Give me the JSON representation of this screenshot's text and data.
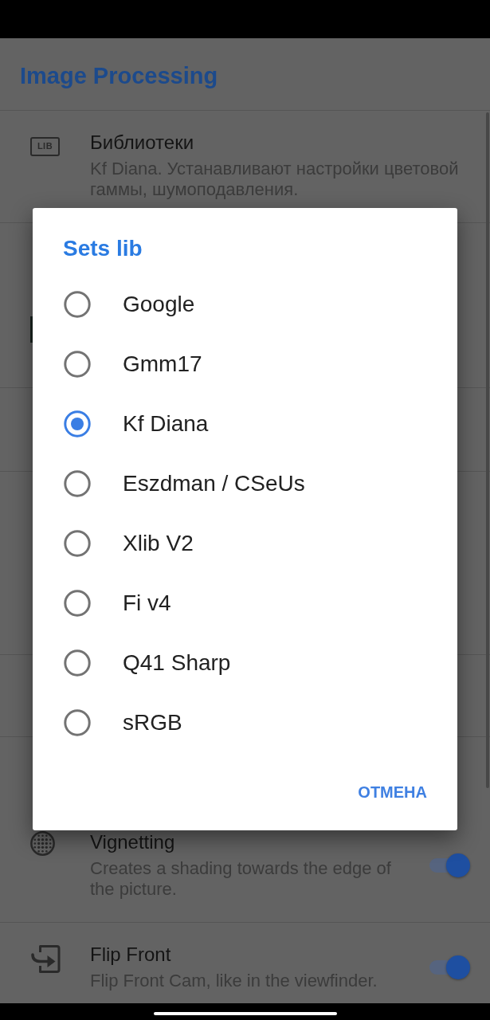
{
  "app_bar": {
    "title": "Image Processing"
  },
  "settings": [
    {
      "kind": "info",
      "icon_label": "LIB",
      "title": "Библиотеки",
      "description": "Kf Diana. Устанавливают настройки цветовой гаммы, шумоподавления."
    },
    {
      "kind": "switch",
      "title": "Vignetting",
      "description": "Creates a shading towards the edge of the picture.",
      "on": true
    },
    {
      "kind": "switch",
      "title": "Flip Front",
      "description": "Flip Front Cam, like in the viewfinder.",
      "on": true
    }
  ],
  "dialog": {
    "title": "Sets lib",
    "options": [
      {
        "label": "Google",
        "selected": false
      },
      {
        "label": "Gmm17",
        "selected": false
      },
      {
        "label": "Kf Diana",
        "selected": true
      },
      {
        "label": "Eszdman / CSeUs",
        "selected": false
      },
      {
        "label": "Xlib V2",
        "selected": false
      },
      {
        "label": "Fi v4",
        "selected": false
      },
      {
        "label": "Q41 Sharp",
        "selected": false
      },
      {
        "label": "sRGB",
        "selected": false
      }
    ],
    "buttons": [
      "ОТМЕНА"
    ]
  }
}
